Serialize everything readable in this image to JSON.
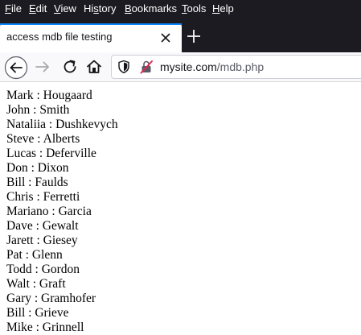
{
  "menu": {
    "items": [
      {
        "accel": "F",
        "rest": "ile"
      },
      {
        "accel": "E",
        "rest": "dit"
      },
      {
        "accel": "V",
        "rest": "iew"
      },
      {
        "accel": "",
        "pre": "Hi",
        "accel2": "s",
        "rest": "tory"
      },
      {
        "accel": "B",
        "rest": "ookmarks"
      },
      {
        "accel": "T",
        "rest": "ools"
      },
      {
        "accel": "H",
        "rest": "elp"
      }
    ]
  },
  "tab": {
    "title": "access mdb file testing",
    "close_icon": "close-icon"
  },
  "newtab_icon": "plus-icon",
  "nav": {
    "back_icon": "back-arrow-icon",
    "forward_icon": "forward-arrow-icon",
    "reload_icon": "reload-icon",
    "home_icon": "home-icon"
  },
  "url": {
    "domain": "mysite.com",
    "path": "/mdb.php",
    "shield_icon": "shield-icon",
    "insecure_icon": "insecure-lock-icon"
  },
  "people": [
    "Mark : Hougaard",
    "John : Smith",
    "Nataliia : Dushkevych",
    "Steve : Alberts",
    "Lucas : Deferville",
    "Don : Dixon",
    "Bill : Faulds",
    "Chris : Ferretti",
    "Mariano : Garcia",
    "Dave : Gewalt",
    "Jarett : Giesey",
    "Pat : Glenn",
    "Todd : Gordon",
    "Walt : Graft",
    "Gary : Gramhofer",
    "Bill : Grieve",
    "Mike : Grinnell"
  ],
  "colors": {
    "chrome_dark": "#1c1b22",
    "tab_accent": "#0a84ff",
    "insecure": "#e22850"
  }
}
